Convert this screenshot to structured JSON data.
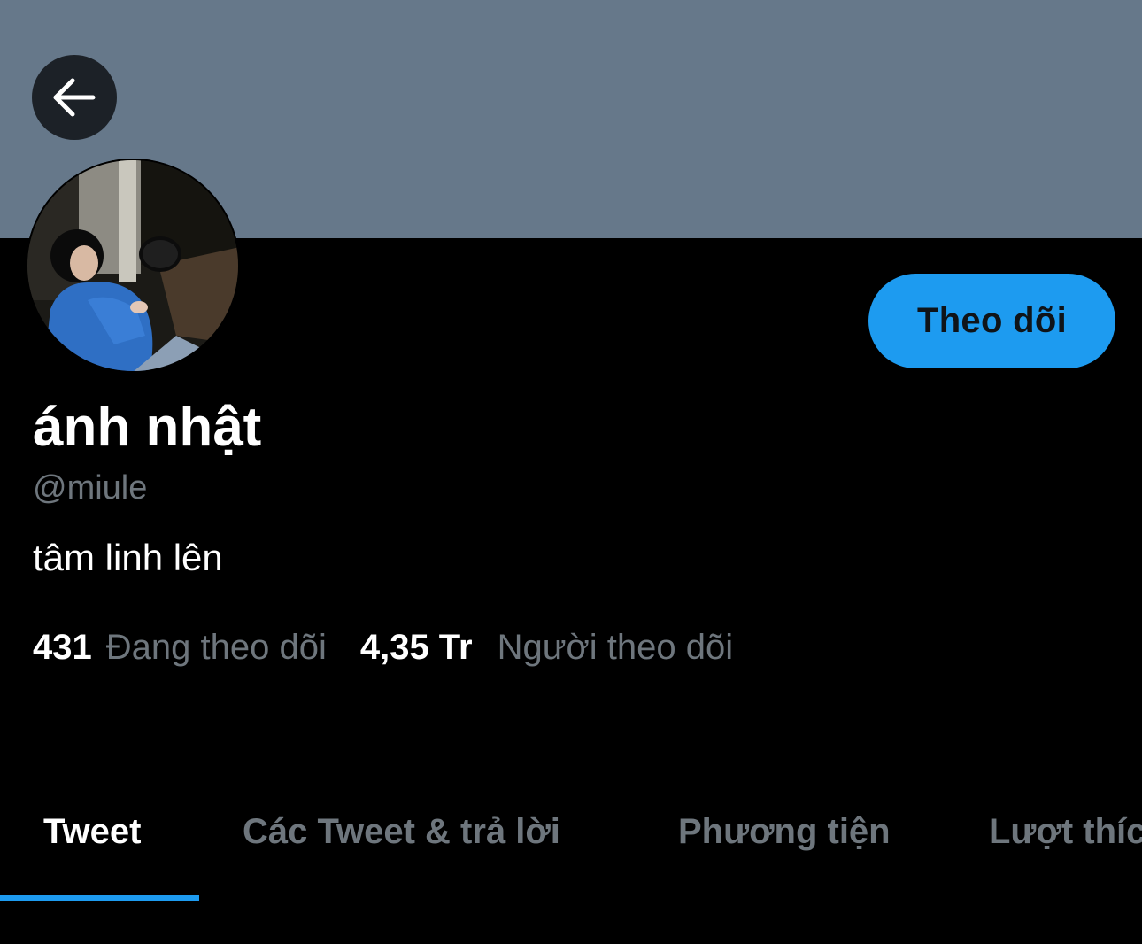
{
  "profile": {
    "display_name": "ánh nhật",
    "handle": "@miule",
    "bio": "tâm linh lên",
    "follow_label": "Theo dõi"
  },
  "stats": {
    "following_count": "431",
    "following_label": "Đang theo dõi",
    "followers_count": "4,35 Tr",
    "followers_label": "Người theo dõi"
  },
  "tabs": [
    {
      "label": "Tweet",
      "active": true
    },
    {
      "label": "Các Tweet & trả lời",
      "active": false
    },
    {
      "label": "Phương tiện",
      "active": false
    },
    {
      "label": "Lượt thích",
      "active": false
    }
  ],
  "icons": {
    "back": "arrow-left-icon"
  },
  "colors": {
    "banner": "#66788a",
    "accent": "#1d9bf0",
    "muted_text": "#6e767d",
    "background": "#000000"
  }
}
